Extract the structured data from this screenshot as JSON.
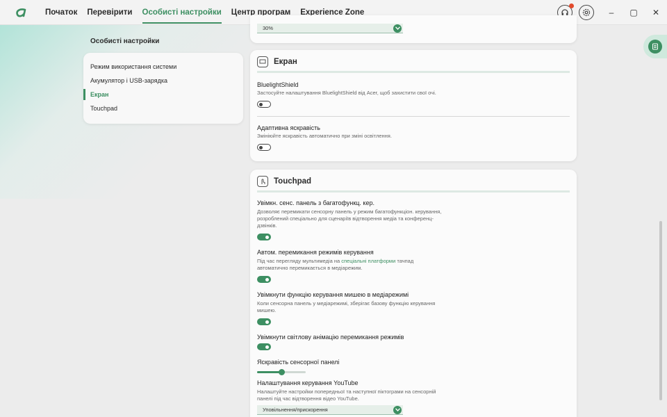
{
  "nav": {
    "items": [
      "Початок",
      "Перевірити",
      "Особисті настройки",
      "Центр програм",
      "Experience Zone"
    ],
    "active_index": 2
  },
  "window_controls": {
    "minimize": "–",
    "maximize": "▢",
    "close": "✕"
  },
  "sidebar": {
    "title": "Особисті настройки",
    "items": [
      "Режим використання системи",
      "Акумулятор і USB-зарядка",
      "Екран",
      "Touchpad"
    ],
    "active_index": 2
  },
  "top_card": {
    "select_value": "30%"
  },
  "screen_card": {
    "title": "Екран",
    "bluelight": {
      "title": "BluelightShield",
      "desc": "Застосуйте налаштування BluelightShield від Acer, щоб захистити свої очі.",
      "enabled": false
    },
    "adaptive": {
      "title": "Адаптивна яскравість",
      "desc": "Змініюйте яскравість автоматично при зміні освітлення.",
      "enabled": false
    }
  },
  "touchpad_card": {
    "title": "Touchpad",
    "multi": {
      "title": "Увімкн. сенс. панель з багатофункц. кер.",
      "desc": "Дозволяє перемикати сенсорну панель у режим багатофункціон. керування, розроблений спеціально для сценаріїв відтворення медіа та конференц-дзвінків.",
      "enabled": true
    },
    "auto_switch": {
      "title": "Автом. перемикання режимів керування",
      "desc_before": "Під час перегляду мультимедіа на ",
      "desc_link": "спеціальні платформи",
      "desc_after": " тачпад автоматично перемикається в медіарежим.",
      "enabled": true
    },
    "mouse": {
      "title": "Увімкнути функцію керування мишею в медіарежимі",
      "desc": "Коли сенсорна панель у медіарежимі, зберігає базову функцію керування мишею.",
      "enabled": true
    },
    "light_anim": {
      "title": "Увімкнути світлову анімацію перемикання режимів",
      "enabled": true
    },
    "brightness": {
      "title": "Яскравість сенсорної панелі",
      "level": 0.5
    },
    "youtube": {
      "title": "Налаштування керування YouTube",
      "desc": "Налаштуйте настройки попередньої та наступної піктограми на сенсорній панелі під час відтворення відео YouTube.",
      "select_value": "Уповільнення/прискорення"
    }
  },
  "colors": {
    "accent": "#3d8f62",
    "notification": "#e24a2c"
  }
}
